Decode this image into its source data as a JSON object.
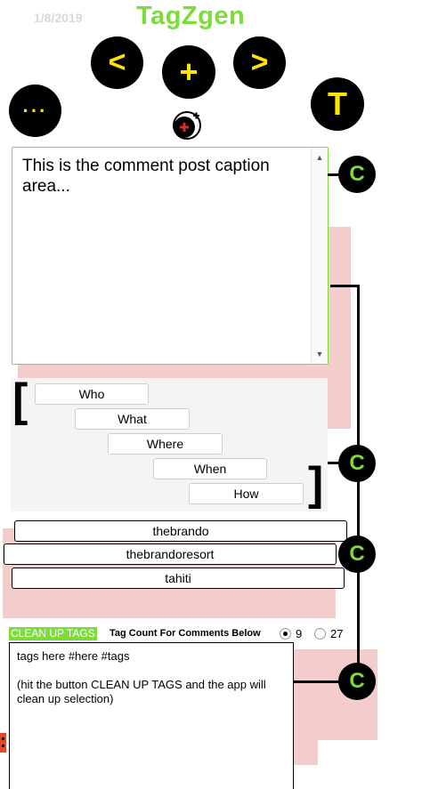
{
  "header": {
    "date": "1/8/2019",
    "title": "TagZgen"
  },
  "nav": {
    "prev_label": "<",
    "add_label": "+",
    "next_label": ">",
    "more_label": "···",
    "text_label": "T"
  },
  "caption": {
    "placeholder": "This is the comment post caption area..."
  },
  "prompts": {
    "items": [
      "Who",
      "What",
      "Where",
      "When",
      "How"
    ]
  },
  "tags": {
    "items": [
      "thebrando",
      "thebrandoresort",
      "tahiti"
    ]
  },
  "copy_buttons": {
    "label": "C"
  },
  "cleanup": {
    "button_label": "CLEAN UP TAGS",
    "count_label": "Tag Count For Comments Below",
    "options": [
      {
        "value": "9",
        "selected": true
      },
      {
        "value": "27",
        "selected": false
      }
    ]
  },
  "output": {
    "text": "tags here #here #tags\n\n(hit the button CLEAN UP TAGS and the app will clean up selection)"
  },
  "colors": {
    "accent_green": "#7ddc3c",
    "button_yellow": "#ffe400",
    "panel_pink": "#f3cccc",
    "date_grey": "#d9d9d9"
  }
}
